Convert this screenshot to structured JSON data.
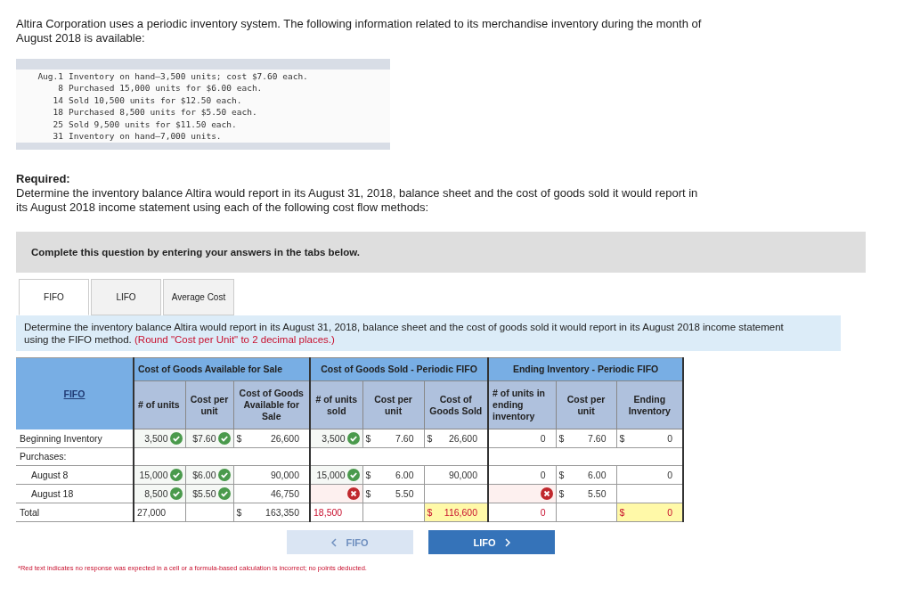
{
  "intro": "Altira Corporation uses a periodic inventory system. The following information related to its merchandise inventory during the month of August 2018 is available:",
  "transactions": [
    {
      "day": "Aug.1",
      "text": "Inventory on hand—3,500 units; cost $7.60 each."
    },
    {
      "day": "8",
      "text": "Purchased 15,000 units for $6.00 each."
    },
    {
      "day": "14",
      "text": "Sold 10,500 units for $12.50 each."
    },
    {
      "day": "18",
      "text": "Purchased 8,500 units for $5.50 each."
    },
    {
      "day": "25",
      "text": "Sold 9,500 units for $11.50 each."
    },
    {
      "day": "31",
      "text": "Inventory on hand—7,000 units."
    }
  ],
  "required": {
    "heading": "Required:",
    "text": "Determine the inventory balance Altira would report in its August 31, 2018, balance sheet and the cost of goods sold it would report in its August 2018 income statement using each of the following cost flow methods:"
  },
  "banner": "Complete this question by entering your answers in the tabs below.",
  "tabs": [
    {
      "label": "FIFO",
      "selected": true
    },
    {
      "label": "LIFO",
      "selected": false
    },
    {
      "label": "Average Cost",
      "selected": false
    }
  ],
  "instruction": {
    "text": "Determine the inventory balance Altira would report in its August 31, 2018, balance sheet and the cost of goods sold it would report in its August 2018 income statement using the FIFO method.",
    "note": "(Round \"Cost per Unit\" to 2 decimal places.)"
  },
  "table": {
    "corner": "FIFO",
    "groups": [
      "Cost of Goods Available for Sale",
      "Cost of Goods Sold - Periodic FIFO",
      "Ending Inventory - Periodic FIFO"
    ],
    "columns": [
      "# of units",
      "Cost per unit",
      "Cost of Goods Available for Sale",
      "# of units sold",
      "Cost per unit",
      "Cost of Goods Sold",
      "# of units in ending inventory",
      "Cost per unit",
      "Ending Inventory"
    ],
    "rows": [
      {
        "label": "Beginning Inventory",
        "indent": false,
        "cells": [
          {
            "text": "3,500",
            "correct": true
          },
          {
            "text": "$7.60",
            "correct": true
          },
          {
            "currency": "$",
            "text": "26,600"
          },
          {
            "text": "3,500",
            "correct": true
          },
          {
            "currency": "$",
            "text": "7.60"
          },
          {
            "currency": "$",
            "text": "26,600"
          },
          {
            "text": "0"
          },
          {
            "currency": "$",
            "text": "7.60"
          },
          {
            "currency": "$",
            "text": "0"
          }
        ]
      },
      {
        "label": "Purchases:",
        "indent": false
      },
      {
        "label": "August 8",
        "indent": true,
        "cells": [
          {
            "text": "15,000",
            "correct": true
          },
          {
            "text": "$6.00",
            "correct": true
          },
          {
            "text": "90,000"
          },
          {
            "text": "15,000",
            "correct": true
          },
          {
            "currency": "$",
            "text": "6.00"
          },
          {
            "text": "90,000"
          },
          {
            "text": "0"
          },
          {
            "currency": "$",
            "text": "6.00"
          },
          {
            "text": "0"
          }
        ]
      },
      {
        "label": "August 18",
        "indent": true,
        "cells": [
          {
            "text": "8,500",
            "correct": true
          },
          {
            "text": "$5.50",
            "correct": true
          },
          {
            "text": "46,750"
          },
          {
            "correct": false
          },
          {
            "currency": "$",
            "text": "5.50"
          },
          null,
          {
            "correct": false
          },
          {
            "currency": "$",
            "text": "5.50"
          },
          null
        ]
      },
      {
        "label": "Total",
        "indent": false,
        "cells": [
          {
            "text": "27,000",
            "left_aligned": true
          },
          null,
          {
            "currency": "$",
            "text": "163,350"
          },
          {
            "text": "18,500",
            "left_aligned": true,
            "red": true
          },
          null,
          {
            "currency": "$",
            "text": "116,600",
            "red": true,
            "highlight": true
          },
          {
            "text": "0",
            "red": true
          },
          null,
          {
            "currency": "$",
            "text": "0",
            "red": true,
            "highlight": true
          }
        ]
      }
    ]
  },
  "nav": [
    {
      "label": "FIFO",
      "kind": "back",
      "disabled": true
    },
    {
      "label": "LIFO",
      "kind": "forward",
      "disabled": false
    }
  ],
  "footnote": "*Red text indicates no response was expected in a cell or a formula-based calculation is incorrect; no points deducted."
}
